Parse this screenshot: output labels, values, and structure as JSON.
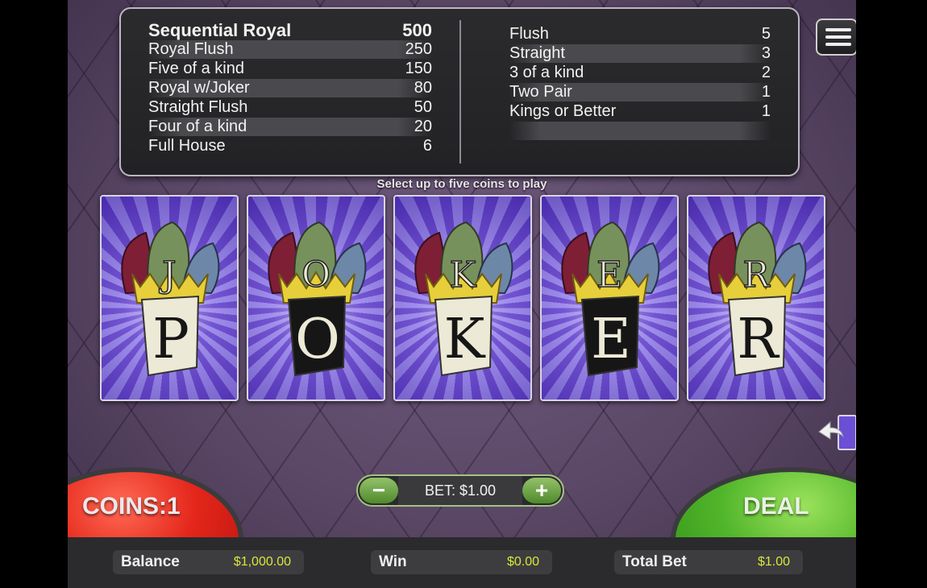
{
  "paytable": {
    "left": [
      {
        "name": "Sequential Royal",
        "value": "500"
      },
      {
        "name": "Royal Flush",
        "value": "250"
      },
      {
        "name": "Five of a kind",
        "value": "150"
      },
      {
        "name": "Royal w/Joker",
        "value": "80"
      },
      {
        "name": "Straight Flush",
        "value": "50"
      },
      {
        "name": "Four of a kind",
        "value": "20"
      },
      {
        "name": "Full House",
        "value": "6"
      }
    ],
    "right": [
      {
        "name": "Flush",
        "value": "5"
      },
      {
        "name": "Straight",
        "value": "3"
      },
      {
        "name": "3 of a kind",
        "value": "2"
      },
      {
        "name": "Two Pair",
        "value": "1"
      },
      {
        "name": "Kings or Better",
        "value": "1"
      }
    ]
  },
  "hint": "Select up to five coins to play",
  "cards": [
    {
      "hat_letter": "J",
      "banner_letter": "P",
      "banner": "light"
    },
    {
      "hat_letter": "O",
      "banner_letter": "O",
      "banner": "dark"
    },
    {
      "hat_letter": "K",
      "banner_letter": "K",
      "banner": "light"
    },
    {
      "hat_letter": "E",
      "banner_letter": "E",
      "banner": "dark"
    },
    {
      "hat_letter": "R",
      "banner_letter": "R",
      "banner": "light"
    }
  ],
  "controls": {
    "coins_label": "COINS:1",
    "deal_label": "DEAL",
    "bet_minus": "−",
    "bet_plus": "+",
    "bet_text": "BET: $1.00"
  },
  "stats": {
    "balance_label": "Balance",
    "balance_value": "$1,000.00",
    "win_label": "Win",
    "win_value": "$0.00",
    "total_bet_label": "Total Bet",
    "total_bet_value": "$1.00"
  },
  "icons": {
    "menu": "hamburger-menu-icon",
    "back": "undo-arrow-icon"
  },
  "colors": {
    "coins_red": "#e4261b",
    "deal_green": "#52b62b",
    "stat_value": "#d9e63a"
  }
}
